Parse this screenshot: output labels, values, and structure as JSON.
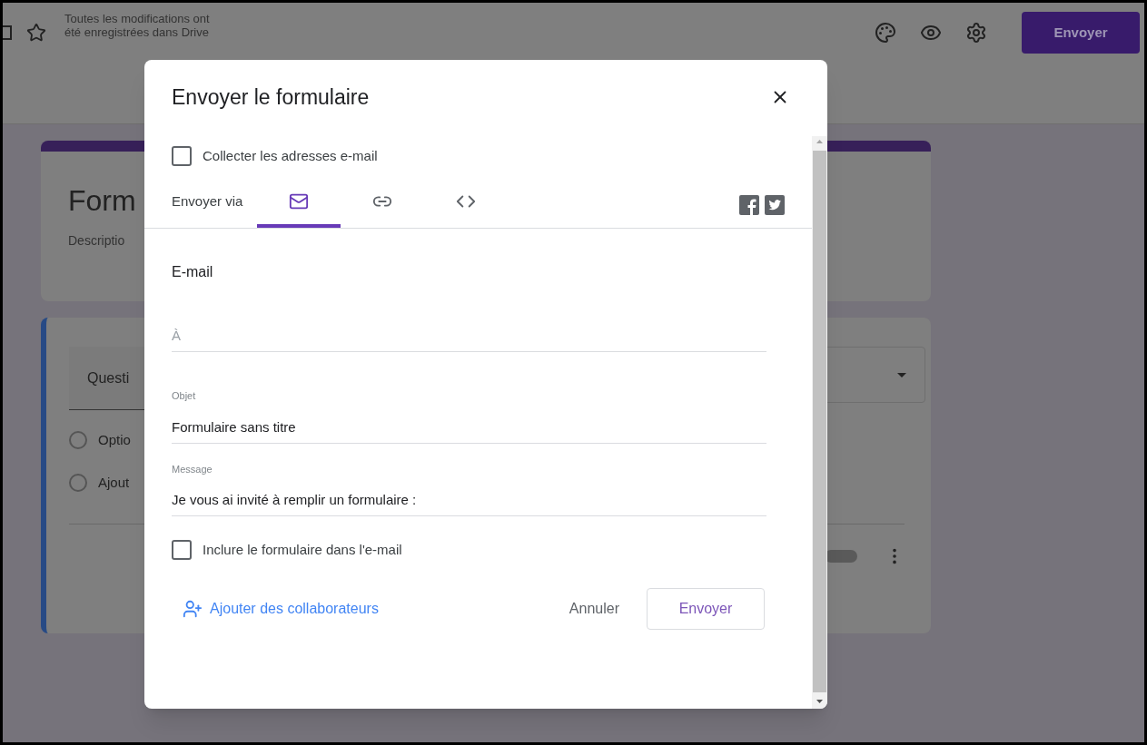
{
  "header": {
    "save_status": "Toutes les modifications ont été enregistrées dans Drive",
    "send_button": "Envoyer"
  },
  "form_card": {
    "title": "Form",
    "description": "Descriptio"
  },
  "question_card": {
    "question": "Questi",
    "options": [
      {
        "label": "Optio",
        "checked": false
      },
      {
        "label": "Ajout",
        "checked": false
      }
    ],
    "required_toggle": {
      "on": false
    }
  },
  "dialog": {
    "title": "Envoyer le formulaire",
    "collect_emails": {
      "label": "Collecter les adresses e-mail",
      "checked": false
    },
    "send_via_label": "Envoyer via",
    "tabs": [
      {
        "kind": "email",
        "selected": true
      },
      {
        "kind": "link",
        "selected": false
      },
      {
        "kind": "embed",
        "selected": false
      }
    ],
    "section_title": "E-mail",
    "to_field": {
      "placeholder": "À"
    },
    "subject_field": {
      "label": "Objet",
      "value": "Formulaire sans titre"
    },
    "message_field": {
      "label": "Message",
      "value": "Je vous ai invité à remplir un formulaire :"
    },
    "include_form": {
      "label": "Inclure le formulaire dans l'e-mail",
      "checked": false
    },
    "add_collaborators": "Ajouter des collaborateurs",
    "cancel_button": "Annuler",
    "send_button": "Envoyer"
  }
}
